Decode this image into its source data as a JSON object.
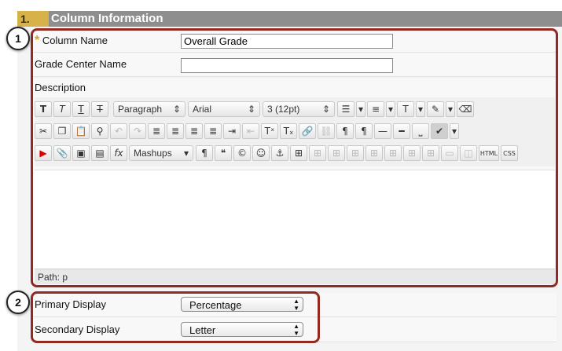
{
  "section": {
    "step_number": "1.",
    "title": "Column Information"
  },
  "column_name": {
    "label": "Column Name",
    "required_marker": "*",
    "value": "Overall Grade"
  },
  "grade_center_name": {
    "label": "Grade Center Name",
    "value": ""
  },
  "description": {
    "label": "Description",
    "toolbar": {
      "paragraph_dropdown": "Paragraph",
      "font_dropdown": "Arial",
      "size_dropdown": "3 (12pt)",
      "mashups_dropdown": "Mashups",
      "html_button": "HTML",
      "css_button": "CSS"
    },
    "path_label": "Path: p"
  },
  "primary_display": {
    "label": "Primary Display",
    "value": "Percentage"
  },
  "secondary_display": {
    "label": "Secondary Display",
    "value": "Letter"
  },
  "callouts": [
    "1",
    "2"
  ],
  "colors": {
    "header_bg": "#8e8e8e",
    "step_bg": "#d7b24a",
    "callout_border": "#922a22",
    "required_star": "#e89a14"
  }
}
